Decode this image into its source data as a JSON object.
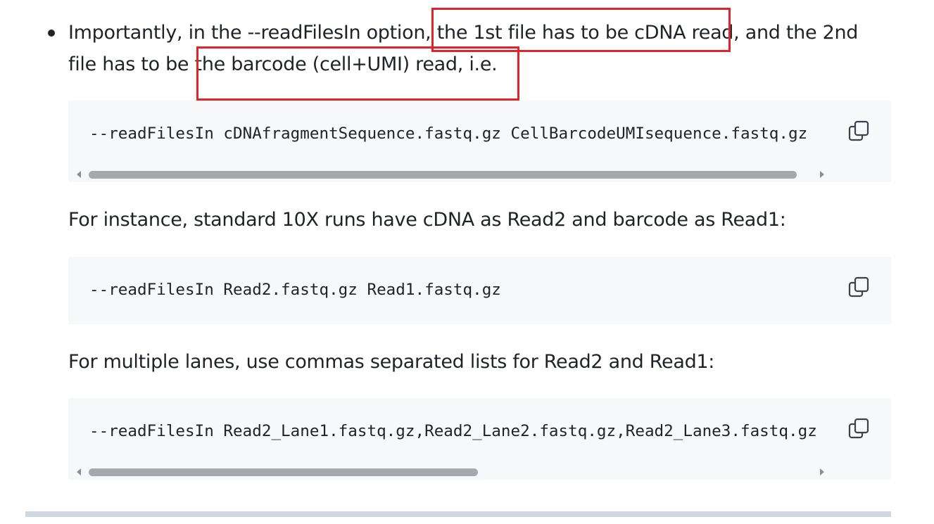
{
  "content": {
    "bullet_line_1": "Importantly, in the --readFilesIn option, the 1st file has to be cDNA read, and the 2nd",
    "bullet_line_2": "file has to be the barcode (cell+UMI) read, i.e.",
    "code_1": "--readFilesIn cDNAfragmentSequence.fastq.gz CellBarcodeUMIsequence.fastq.gz",
    "para_instance": "For instance, standard 10X runs have cDNA as Read2 and barcode as Read1:",
    "code_2": "--readFilesIn Read2.fastq.gz Read1.fastq.gz",
    "para_lanes": "For multiple lanes, use commas separated lists for Read2 and Read1:",
    "code_3": "--readFilesIn Read2_Lane1.fastq.gz,Read2_Lane2.fastq.gz,Read2_Lane3.fastq.gz"
  },
  "icons": {
    "copy": "copy-icon"
  },
  "colors": {
    "text": "#1f2328",
    "code_background": "#f6f8fa",
    "highlight_annotation": "#e0242b",
    "scrollbar_thumb": "#a6a8ab"
  }
}
